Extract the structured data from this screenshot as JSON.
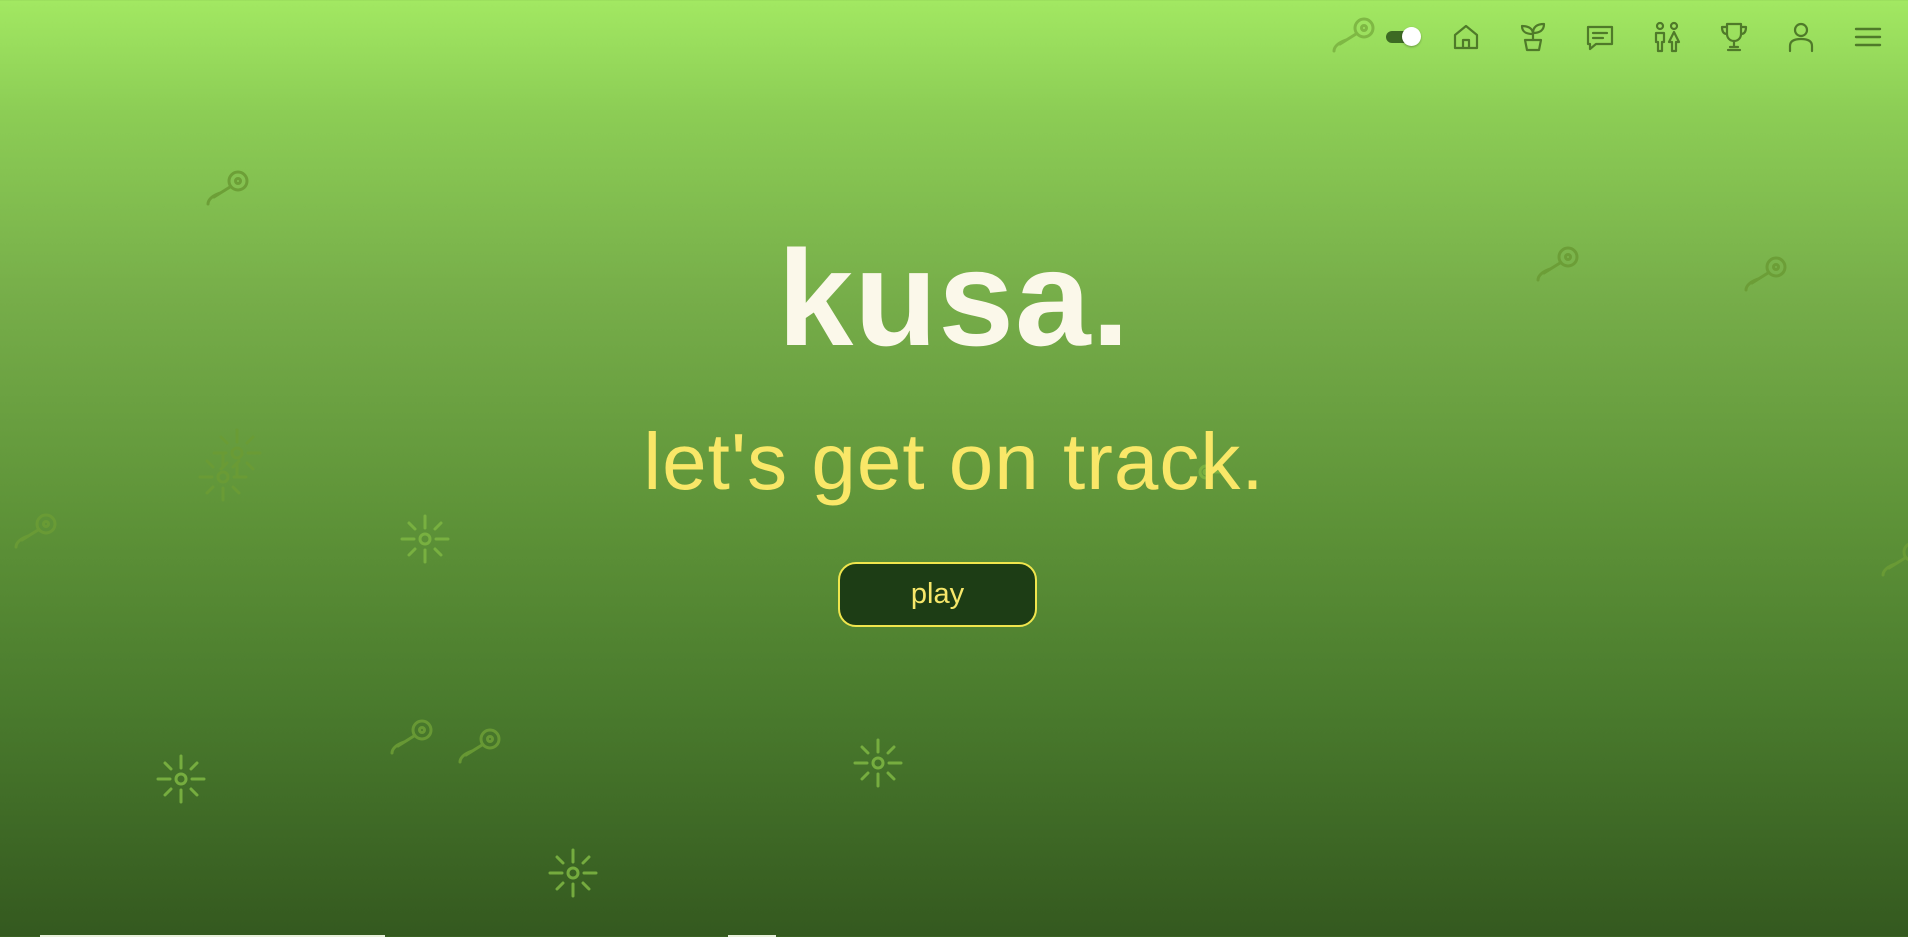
{
  "app": {
    "brand_title": "kusa.",
    "tagline": "let's get on track.",
    "play_label": "play"
  },
  "nav": {
    "theme_toggle_on": true,
    "items": [
      {
        "icon": "home-icon"
      },
      {
        "icon": "sprout-icon"
      },
      {
        "icon": "chat-icon"
      },
      {
        "icon": "people-icon"
      },
      {
        "icon": "trophy-icon"
      },
      {
        "icon": "user-icon"
      },
      {
        "icon": "menu-icon"
      }
    ]
  },
  "colors": {
    "title": "#fbf8ea",
    "tagline": "#f9e768",
    "button_bg": "#1d3d15",
    "button_border": "#f0e64d",
    "icons": "#4f7a29"
  }
}
